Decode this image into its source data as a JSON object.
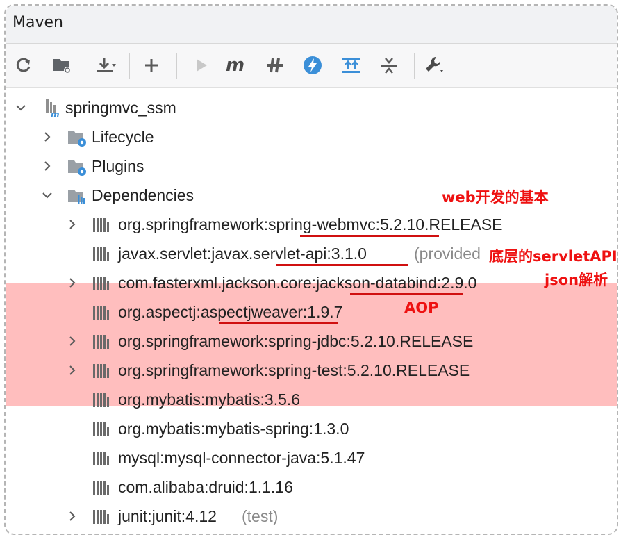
{
  "panel": {
    "title": "Maven"
  },
  "toolbar": {
    "items": [
      "refresh-icon",
      "generate-sources-icon",
      "download-icon",
      "add-icon",
      "run-icon",
      "execute-goal-icon",
      "toggle-offline-icon",
      "skip-tests-icon",
      "show-dependencies-icon",
      "collapse-all-icon",
      "settings-icon"
    ]
  },
  "tree": {
    "project": "springmvc_ssm",
    "lifecycle": "Lifecycle",
    "plugins": "Plugins",
    "dependencies": "Dependencies",
    "deps": [
      {
        "text": "org.springframework:spring-webmvc:5.2.10.RELEASE",
        "suffix": ""
      },
      {
        "text": "javax.servlet:javax.servlet-api:3.1.0",
        "suffix": "(provided"
      },
      {
        "text": "com.fasterxml.jackson.core:jackson-databind:2.9.0",
        "suffix": ""
      },
      {
        "text": "org.aspectj:aspectjweaver:1.9.7",
        "suffix": ""
      },
      {
        "text": "org.springframework:spring-jdbc:5.2.10.RELEASE",
        "suffix": ""
      },
      {
        "text": "org.springframework:spring-test:5.2.10.RELEASE",
        "suffix": ""
      },
      {
        "text": "org.mybatis:mybatis:3.5.6",
        "suffix": ""
      },
      {
        "text": "org.mybatis:mybatis-spring:1.3.0",
        "suffix": ""
      },
      {
        "text": "mysql:mysql-connector-java:5.1.47",
        "suffix": ""
      },
      {
        "text": "com.alibaba:druid:1.1.16",
        "suffix": ""
      },
      {
        "text": "junit:junit:4.12",
        "suffix": "(test)"
      }
    ]
  },
  "annotations": {
    "web": "web开发的基本",
    "servlet": "底层的servletAPI",
    "json": "json解析",
    "aop": "AOP"
  },
  "colors": {
    "highlight": "#ff9696",
    "annotation": "#ee1111",
    "underline": "#d01010"
  }
}
